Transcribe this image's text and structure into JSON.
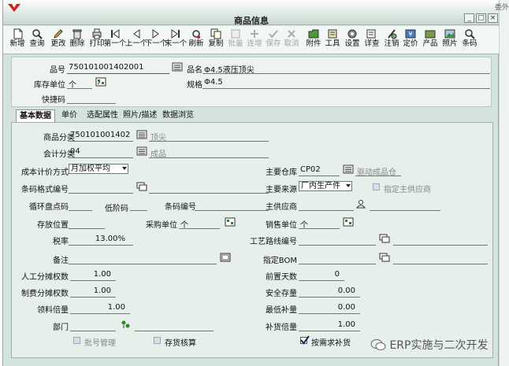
{
  "window": {
    "title": "商品信息",
    "side_text": "委外",
    "min_label": "_",
    "max_label": "□",
    "close_label": "×"
  },
  "toolbar": [
    {
      "id": "new",
      "label": "新增",
      "icon": "new-doc-icon",
      "disabled": false
    },
    {
      "id": "query",
      "label": "查询",
      "icon": "search-icon",
      "disabled": false
    },
    {
      "id": "edit",
      "label": "更改",
      "icon": "pencil-icon",
      "disabled": false
    },
    {
      "id": "delete",
      "label": "删除",
      "icon": "trash-icon",
      "disabled": false
    },
    {
      "id": "print",
      "label": "打印",
      "icon": "printer-icon",
      "disabled": false
    },
    {
      "id": "first",
      "label": "第一个",
      "icon": "first-record-icon",
      "disabled": false
    },
    {
      "id": "prev",
      "label": "上一个",
      "icon": "prev-record-icon",
      "disabled": false
    },
    {
      "id": "next",
      "label": "下一个",
      "icon": "next-record-icon",
      "disabled": false
    },
    {
      "id": "last",
      "label": "末一个",
      "icon": "last-record-icon",
      "disabled": false
    },
    {
      "id": "refresh",
      "label": "刷新",
      "icon": "refresh-icon",
      "disabled": false
    },
    {
      "id": "copy",
      "label": "复制",
      "icon": "copy-icon",
      "disabled": false
    },
    {
      "id": "batch",
      "label": "批量",
      "icon": "batch-icon",
      "disabled": true
    },
    {
      "id": "continuous",
      "label": "连增",
      "icon": "plus-icon",
      "disabled": true
    },
    {
      "id": "save",
      "label": "保存",
      "icon": "check-icon",
      "disabled": true
    },
    {
      "id": "cancel",
      "label": "取消",
      "icon": "cancel-icon",
      "disabled": true
    },
    {
      "id": "attach",
      "label": "附件",
      "icon": "folder-icon",
      "disabled": false
    },
    {
      "id": "tools",
      "label": "工具",
      "icon": "tools-icon",
      "disabled": false
    },
    {
      "id": "settings",
      "label": "设置",
      "icon": "gear-icon",
      "disabled": false
    },
    {
      "id": "detail",
      "label": "详查",
      "icon": "detail-icon",
      "disabled": false
    },
    {
      "id": "cancel-reg",
      "label": "注销",
      "icon": "deregister-icon",
      "disabled": false
    },
    {
      "id": "price",
      "label": "定价",
      "icon": "price-icon",
      "disabled": false
    },
    {
      "id": "product",
      "label": "产品",
      "icon": "product-icon",
      "disabled": false
    },
    {
      "id": "photo",
      "label": "照片",
      "icon": "photo-icon",
      "disabled": false
    },
    {
      "id": "barcode",
      "label": "条码",
      "icon": "barcode-search-icon",
      "disabled": false
    }
  ],
  "header": {
    "code_label": "品号",
    "code_value": "750101001402001",
    "name_label": "品名",
    "name_value": "Φ4.5液压顶尖",
    "unit_label": "库存单位",
    "unit_value": "个",
    "spec_label": "规格",
    "spec_value": "Φ4.5",
    "quick_label": "快捷码",
    "quick_value": ""
  },
  "tabs": [
    {
      "label": "基本数据",
      "active": true
    },
    {
      "label": "单价",
      "active": false
    },
    {
      "label": "选配属性",
      "active": false
    },
    {
      "label": "照片/描述",
      "active": false
    },
    {
      "label": "数据浏览",
      "active": false
    }
  ],
  "basic": {
    "category_label": "商品分类",
    "category_value": "750101001402",
    "category_name": "顶尖",
    "account_label": "会计分类",
    "account_value": "04",
    "account_name": "成品",
    "cost_label": "成本计价方式",
    "cost_value": "月加权平均",
    "barcode_label": "条码格式编号",
    "barcode_value": "",
    "cycle_label": "循环盘点码",
    "low_label": "低阶码",
    "bar_no_label": "条码编号",
    "stock_pos_label": "存放位置",
    "purchase_unit_label": "采购单位",
    "purchase_unit_value": "个",
    "tax_label": "税率",
    "tax_value": "13.00%",
    "remark_label": "备注",
    "labor_label": "人工分摊权数",
    "labor_value": "1.00",
    "mfg_label": "制费分摊权数",
    "mfg_value": "1.00",
    "issue_label": "领料倍量",
    "issue_value": "1.00",
    "dept_label": "部门",
    "batch_mgmt_label": "批号管理",
    "stock_check_label": "存货核算",
    "warehouse_label": "主要仓库",
    "warehouse_value": "CP02",
    "warehouse_name": "驱动成品仓",
    "source_label": "主要来源",
    "source_value": "厂内生产件",
    "assign_supplier_label": "指定主供应商",
    "main_supplier_label": "主供应商",
    "sales_unit_label": "销售单位",
    "sales_unit_value": "个",
    "route_label": "工艺路线编号",
    "bom_label": "指定BOM",
    "lead_label": "前置天数",
    "lead_value": "0",
    "safety_label": "安全存量",
    "safety_value": "0.00",
    "min_label": "最低补量",
    "min_value": "0.00",
    "reorder_label": "补货倍量",
    "reorder_value": "1.00",
    "demand_label": "按需求补货"
  },
  "watermark": "ERP实施与二次开发"
}
